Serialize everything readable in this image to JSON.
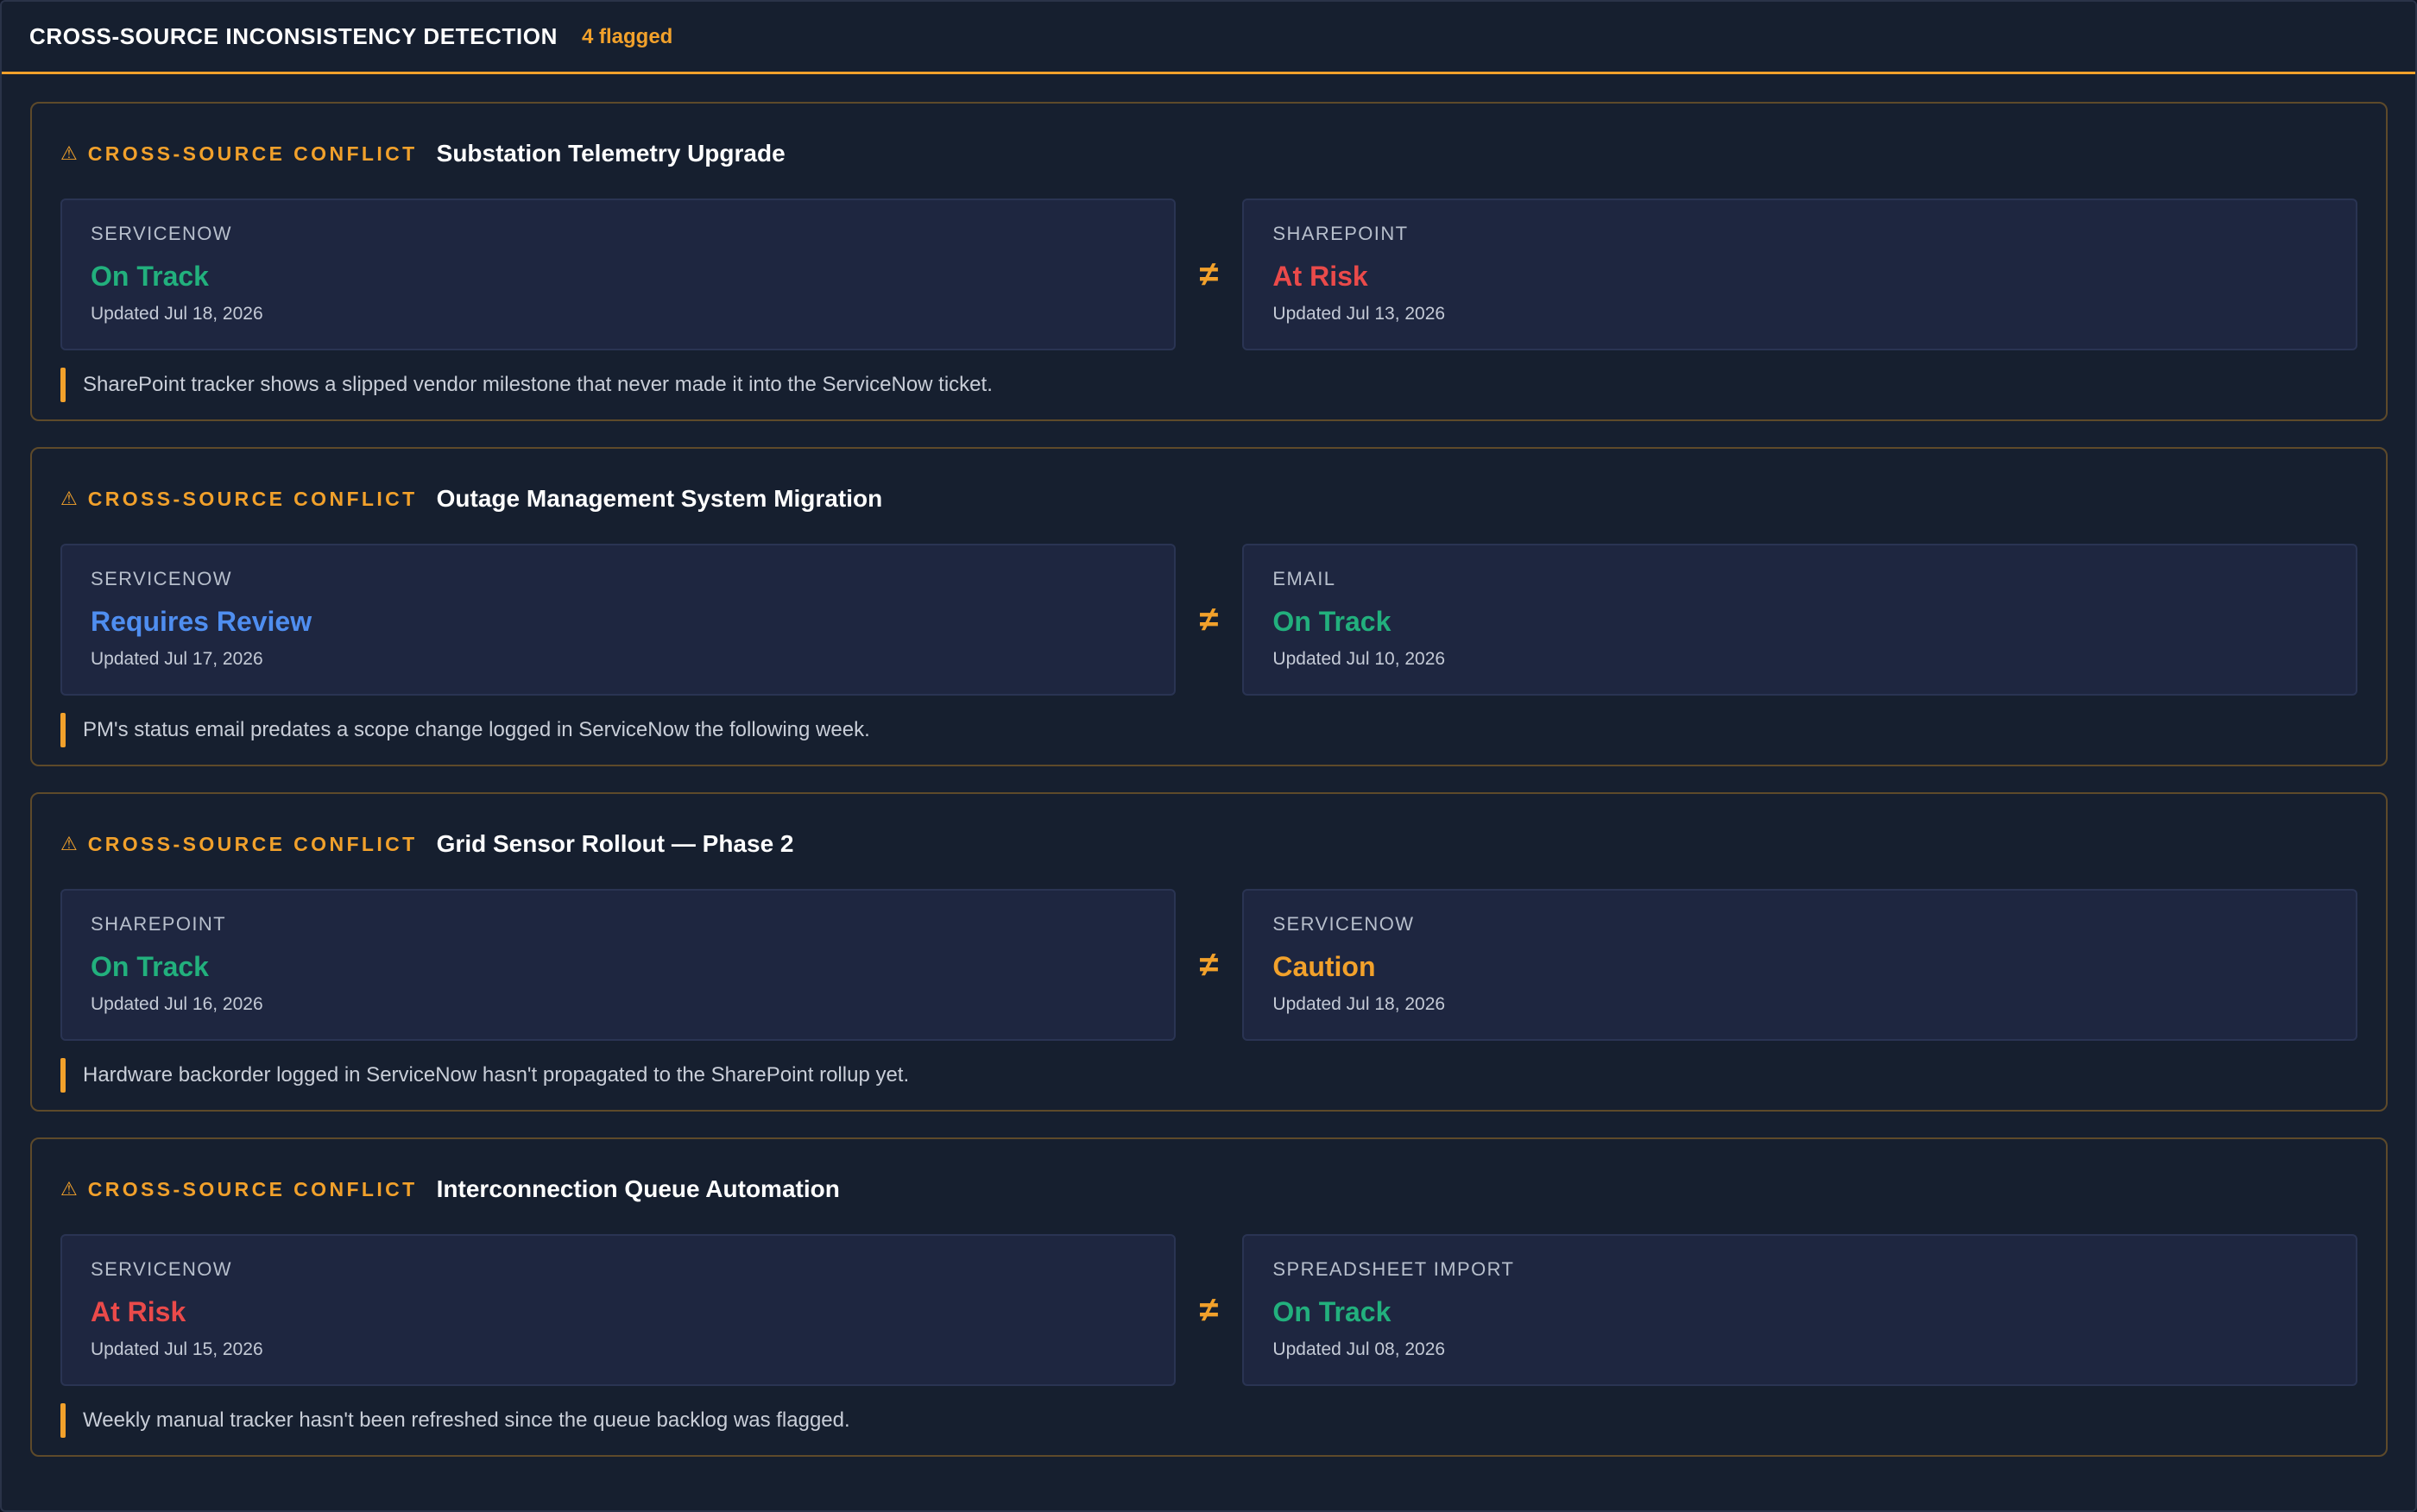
{
  "header": {
    "title": "CROSS-SOURCE INCONSISTENCY DETECTION",
    "count": "4 flagged"
  },
  "colors": {
    "accent": "#f2a12b",
    "on_track": "#22b07d",
    "at_risk": "#ea4a4a",
    "requires_review": "#4f8ef0",
    "caution": "#f2a12b"
  },
  "conflicts": [
    {
      "tag": "CROSS-SOURCE CONFLICT",
      "title": "Substation Telemetry Upgrade",
      "left": {
        "source": "SERVICENOW",
        "status": "On Track",
        "status_key": "on_track",
        "updated": "Updated Jul 18, 2026"
      },
      "symbol": "≠",
      "right": {
        "source": "SHAREPOINT",
        "status": "At Risk",
        "status_key": "at_risk",
        "updated": "Updated Jul 13, 2026"
      },
      "note": "SharePoint tracker shows a slipped vendor milestone that never made it into the ServiceNow ticket."
    },
    {
      "tag": "CROSS-SOURCE CONFLICT",
      "title": "Outage Management System Migration",
      "left": {
        "source": "SERVICENOW",
        "status": "Requires Review",
        "status_key": "requires_review",
        "updated": "Updated Jul 17, 2026"
      },
      "symbol": "≠",
      "right": {
        "source": "EMAIL",
        "status": "On Track",
        "status_key": "on_track",
        "updated": "Updated Jul 10, 2026"
      },
      "note": "PM's status email predates a scope change logged in ServiceNow the following week."
    },
    {
      "tag": "CROSS-SOURCE CONFLICT",
      "title": "Grid Sensor Rollout — Phase 2",
      "left": {
        "source": "SHAREPOINT",
        "status": "On Track",
        "status_key": "on_track",
        "updated": "Updated Jul 16, 2026"
      },
      "symbol": "≠",
      "right": {
        "source": "SERVICENOW",
        "status": "Caution",
        "status_key": "caution",
        "updated": "Updated Jul 18, 2026"
      },
      "note": "Hardware backorder logged in ServiceNow hasn't propagated to the SharePoint rollup yet."
    },
    {
      "tag": "CROSS-SOURCE CONFLICT",
      "title": "Interconnection Queue Automation",
      "left": {
        "source": "SERVICENOW",
        "status": "At Risk",
        "status_key": "at_risk",
        "updated": "Updated Jul 15, 2026"
      },
      "symbol": "≠",
      "right": {
        "source": "SPREADSHEET IMPORT",
        "status": "On Track",
        "status_key": "on_track",
        "updated": "Updated Jul 08, 2026"
      },
      "note": "Weekly manual tracker hasn't been refreshed since the queue backlog was flagged."
    }
  ]
}
